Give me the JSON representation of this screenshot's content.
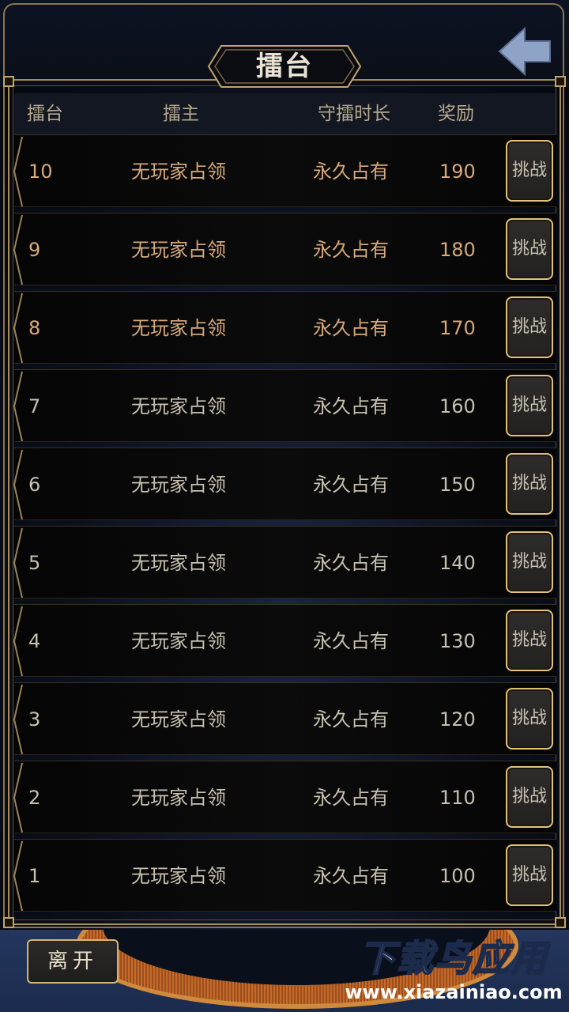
{
  "header": {
    "title": "擂台"
  },
  "columns": {
    "rank": "擂台",
    "owner": "擂主",
    "duration": "守擂时长",
    "reward": "奖励"
  },
  "rows": [
    {
      "rank": "10",
      "owner": "无玩家占领",
      "duration": "永久占有",
      "reward": "190",
      "action": "挑战",
      "highlight": true
    },
    {
      "rank": "9",
      "owner": "无玩家占领",
      "duration": "永久占有",
      "reward": "180",
      "action": "挑战",
      "highlight": true
    },
    {
      "rank": "8",
      "owner": "无玩家占领",
      "duration": "永久占有",
      "reward": "170",
      "action": "挑战",
      "highlight": true
    },
    {
      "rank": "7",
      "owner": "无玩家占领",
      "duration": "永久占有",
      "reward": "160",
      "action": "挑战",
      "highlight": false
    },
    {
      "rank": "6",
      "owner": "无玩家占领",
      "duration": "永久占有",
      "reward": "150",
      "action": "挑战",
      "highlight": false
    },
    {
      "rank": "5",
      "owner": "无玩家占领",
      "duration": "永久占有",
      "reward": "140",
      "action": "挑战",
      "highlight": false
    },
    {
      "rank": "4",
      "owner": "无玩家占领",
      "duration": "永久占有",
      "reward": "130",
      "action": "挑战",
      "highlight": false
    },
    {
      "rank": "3",
      "owner": "无玩家占领",
      "duration": "永久占有",
      "reward": "120",
      "action": "挑战",
      "highlight": false
    },
    {
      "rank": "2",
      "owner": "无玩家占领",
      "duration": "永久占有",
      "reward": "110",
      "action": "挑战",
      "highlight": false
    },
    {
      "rank": "1",
      "owner": "无玩家占领",
      "duration": "永久占有",
      "reward": "100",
      "action": "挑战",
      "highlight": false
    }
  ],
  "footer": {
    "leave_label": "离开",
    "watermark_logo": "下载鸟应用",
    "watermark_url": "www.xiazainiao.com"
  },
  "icons": {
    "back": "back-arrow-icon"
  },
  "colors": {
    "gold_border": "#d7b471",
    "highlight_text": "#d7a97a",
    "normal_text": "#c8c0b0",
    "bottom_bar": "#24365e"
  }
}
